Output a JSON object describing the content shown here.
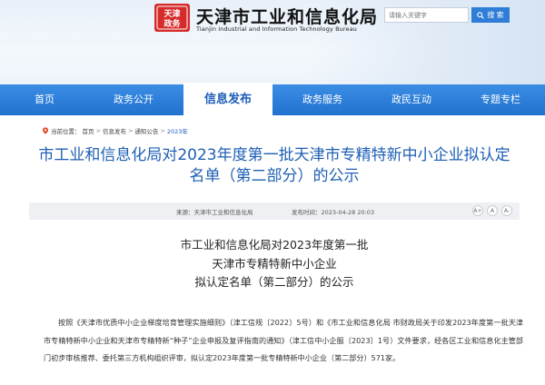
{
  "header": {
    "logo_text": "天津政务",
    "title": "天津市工业和信息化局",
    "subtitle": "Tianjin Industrial and Information Technology Bureau",
    "search_placeholder": "请输入关键字",
    "search_label": "搜 索",
    "search_icon": "search-icon"
  },
  "nav": {
    "items": [
      "首页",
      "政务公开",
      "信息发布",
      "政务服务",
      "政民互动",
      "专题专栏"
    ],
    "active_index": 2
  },
  "breadcrumb": {
    "prefix": "当前位置：",
    "items": [
      "首页",
      "信息发布",
      "通知公告",
      "2023年"
    ],
    "separator": ">"
  },
  "article": {
    "title": "市工业和信息化局对2023年度第一批天津市专精特新中小企业拟认定名单（第二部分）的公示",
    "source": "来源：天津市工业和信息化局",
    "date": "发布时间：2023-04-28 20:03",
    "font_controls": [
      "A+",
      "A",
      "A-"
    ],
    "heading_lines": [
      "市工业和信息化局对2023年度第一批",
      "天津市专精特新中小企业",
      "拟认定名单（第二部分）的公示"
    ],
    "body": "按照《天津市优质中小企业梯度培育管理实施细则》（津工信规〔2022〕5号）和《市工业和信息化局 市财政局关于印发2023年度第一批天津市专精特新中小企业和天津市专精特新“种子”企业申报及复评指南的通知》（津工信中小企服〔2023〕1号）文件要求，经各区工业和信息化主管部门初步审核推荐、委托第三方机构组织评审，拟认定2023年度第一批专精特新中小企业（第二部分）571家。"
  },
  "colors": {
    "nav_blue": "#2e7dd6",
    "title_blue": "#1e5fb4",
    "search_button": "#2e7dd6",
    "logo_red": "#d62b2b"
  }
}
